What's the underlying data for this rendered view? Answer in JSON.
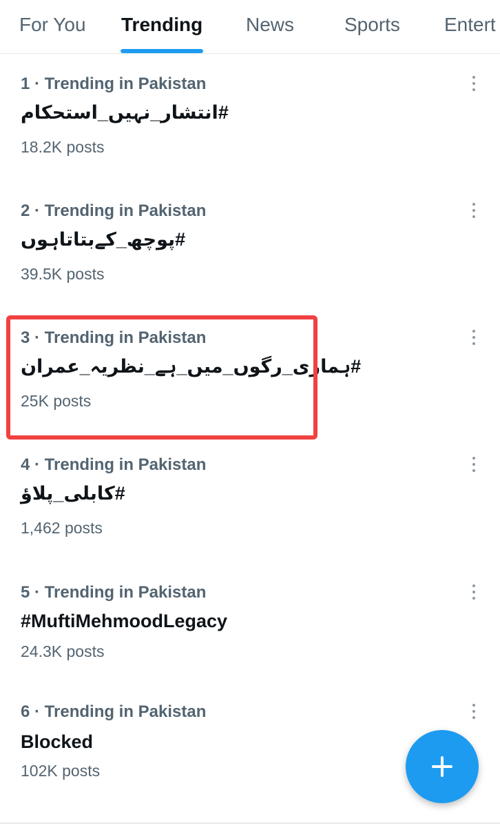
{
  "tabs": [
    {
      "label": "For You",
      "active": false
    },
    {
      "label": "Trending",
      "active": true
    },
    {
      "label": "News",
      "active": false
    },
    {
      "label": "Sports",
      "active": false
    },
    {
      "label": "Entert",
      "active": false
    }
  ],
  "trends": [
    {
      "meta": "1 · Trending in Pakistan",
      "name": "#انتشار_نہیں_استحکام",
      "posts": "18.2K posts"
    },
    {
      "meta": "2 · Trending in Pakistan",
      "name": "#پوچھ_کےبتاتاہوں",
      "posts": "39.5K posts"
    },
    {
      "meta": "3 · Trending in Pakistan",
      "name": "#ہماری_رگوں_میں_ہے_نظریہ_عمران",
      "posts": "25K posts"
    },
    {
      "meta": "4 · Trending in Pakistan",
      "name": "#کابلی_پلاؤ",
      "posts": "1,462 posts"
    },
    {
      "meta": "5 · Trending in Pakistan",
      "name": "#MuftiMehmoodLegacy",
      "posts": "24.3K posts"
    },
    {
      "meta": "6 · Trending in Pakistan",
      "name": "Blocked",
      "posts": "102K posts"
    }
  ],
  "colors": {
    "accent": "#1d9bf0",
    "highlight_box": "#f14141",
    "secondary_text": "#536471"
  },
  "icons": {
    "more": "more-vertical-icon",
    "compose": "plus-icon"
  }
}
